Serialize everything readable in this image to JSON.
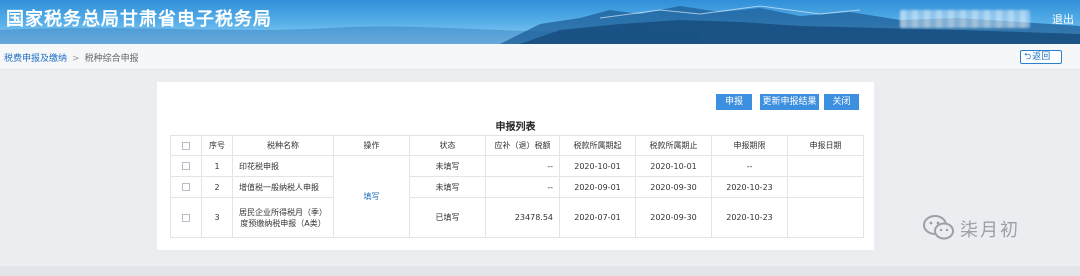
{
  "header": {
    "title": "国家税务总局甘肃省电子税务局",
    "logout_label": "退出"
  },
  "breadcrumb": {
    "parent": "税费申报及缴纳",
    "separator": ">",
    "current": "税种综合申报"
  },
  "back_button_label": "返回",
  "toolbar": {
    "report_label": "申报",
    "refresh_label": "更新申报结果",
    "close_label": "关闭"
  },
  "list_title": "申报列表",
  "table": {
    "headers": [
      "序号",
      "税种名称",
      "操作",
      "状态",
      "应补（退）税额",
      "税款所属期起",
      "税款所属期止",
      "申报期限",
      "申报日期"
    ],
    "fill_action": "填写",
    "rows": [
      {
        "no": "1",
        "name": "印花税申报",
        "status": "未填写",
        "amount": "--",
        "start": "2020-10-01",
        "end": "2020-10-01",
        "deadline": "--",
        "date": ""
      },
      {
        "no": "2",
        "name": "增值税一般纳税人申报",
        "status": "未填写",
        "amount": "--",
        "start": "2020-09-01",
        "end": "2020-09-30",
        "deadline": "2020-10-23",
        "date": ""
      },
      {
        "no": "3",
        "name": "居民企业所得税月（季）度预缴纳税申报（A类）",
        "status": "已填写",
        "amount": "23478.54",
        "start": "2020-07-01",
        "end": "2020-09-30",
        "deadline": "2020-10-23",
        "date": ""
      }
    ]
  },
  "watermark": "柒月初",
  "colors": {
    "header_blue": "#2f8fd8",
    "button_blue": "#3d8fe0",
    "link_blue": "#1e6fc2"
  }
}
